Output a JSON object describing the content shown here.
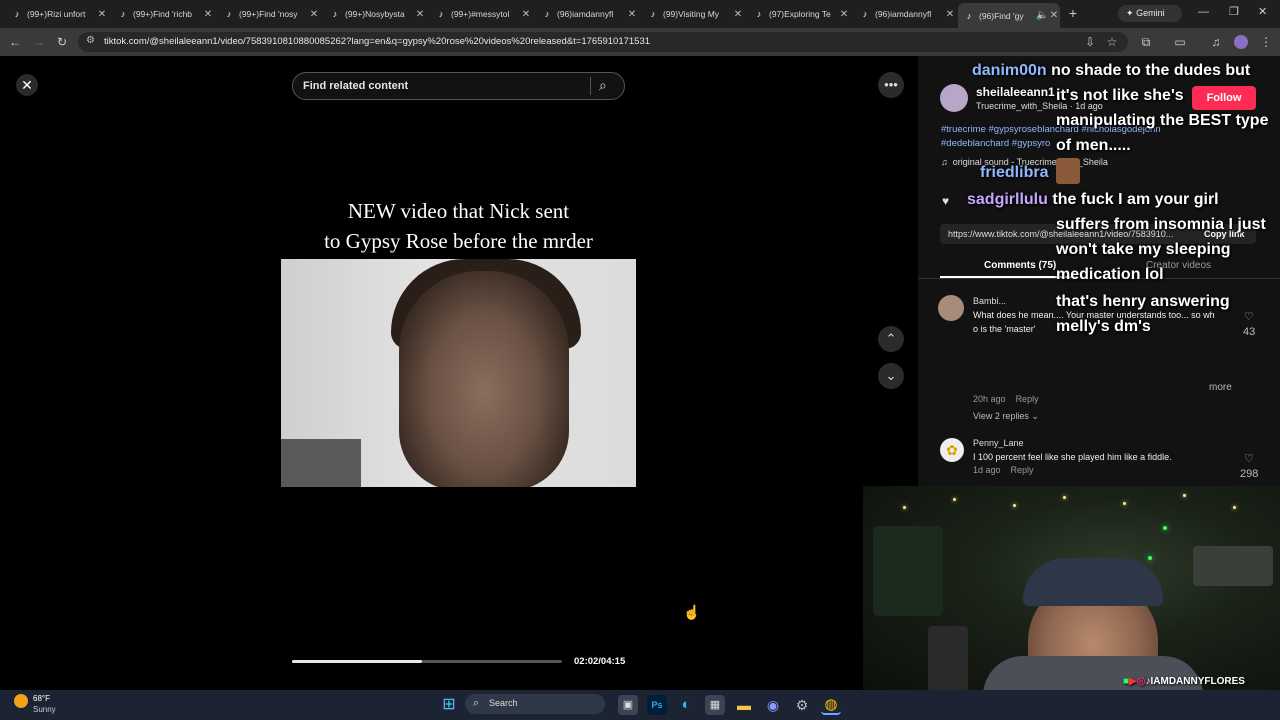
{
  "tabs": [
    {
      "label": "(99+)Rizi unfort"
    },
    {
      "label": "(99+)Find 'richb"
    },
    {
      "label": "(99+)Find 'nosy"
    },
    {
      "label": "(99+)Nosybysta"
    },
    {
      "label": "(99+)#messytol"
    },
    {
      "label": "(96)iamdannyfl"
    },
    {
      "label": "(99)Visiting My"
    },
    {
      "label": "(97)Exploring Te"
    },
    {
      "label": "(96)iamdannyfl"
    },
    {
      "label": "(96)Find 'gy"
    }
  ],
  "gemini_label": "Gemini",
  "url": "tiktok.com/@sheilaleeann1/video/7583910810880085262?lang=en&q=gypsy%20rose%20videos%20released&t=1765910171531",
  "search": {
    "placeholder": "Find related content"
  },
  "video": {
    "caption_line1": "NEW video that Nick sent",
    "caption_line2": "to Gypsy Rose before the mrder",
    "time": "02:02/04:15",
    "progress": 0.48
  },
  "author": {
    "name": "sheilaleeann1",
    "sub": "Truecrime_with_Sheila · 1d ago",
    "follow_label": "Follow"
  },
  "post": {
    "hashtags_line1": "#truecrime #gypsyroseblanchard #nicholasgodejohn",
    "hashtags_line2": "#dedeblanchard #gypsyro",
    "sound": "original sound - Truecrime_with_Sheila",
    "link": "https://www.tiktok.com/@sheilaleeann1/video/7583910...",
    "copy_link": "Copy link"
  },
  "tabs_panel": {
    "comments": "Comments (75)",
    "creator": "Creator videos"
  },
  "comments": [
    {
      "user": "Bambi...",
      "text_line1": "What does he mean.... Your master understands too... so wh",
      "text_line2": "o is the 'master'",
      "likes": "43",
      "time": "20h ago",
      "reply": "Reply",
      "view_replies": "View 2 replies",
      "more": "more"
    },
    {
      "user": "Penny_Lane",
      "text_line1": "I 100 percent feel like she played him like a fiddle.",
      "time": "1d ago",
      "reply": "Reply",
      "likes": "298"
    }
  ],
  "stream_chat": [
    {
      "user": "danim00n",
      "color": "#8fb8ff",
      "msg": "no shade to the dudes but"
    },
    {
      "msg": "it's not like she's"
    },
    {
      "msg": "manipulating the BEST type"
    },
    {
      "msg": "of men....."
    },
    {
      "user": "friedlibra",
      "color": "#8fb8ff"
    },
    {
      "user": "sadgirllulu",
      "color": "#c7a6ff",
      "msg": "the fuck I am your girl"
    },
    {
      "msg": "suffers from insomnia I just"
    },
    {
      "msg": "won't take my sleeping"
    },
    {
      "msg": "medication lol"
    },
    {
      "msg": "that's henry answering"
    },
    {
      "msg": "melly's dm's"
    }
  ],
  "streamer_handle": "IAMDANNYFLORES",
  "weather": {
    "temp": "68°F",
    "condition": "Sunny"
  },
  "taskbar": {
    "search_label": "Search"
  },
  "colors": {
    "follow": "#fe2c55",
    "hashtag": "#8fb8ff",
    "chat_blue": "#8fb8ff",
    "bg": "#000000"
  }
}
